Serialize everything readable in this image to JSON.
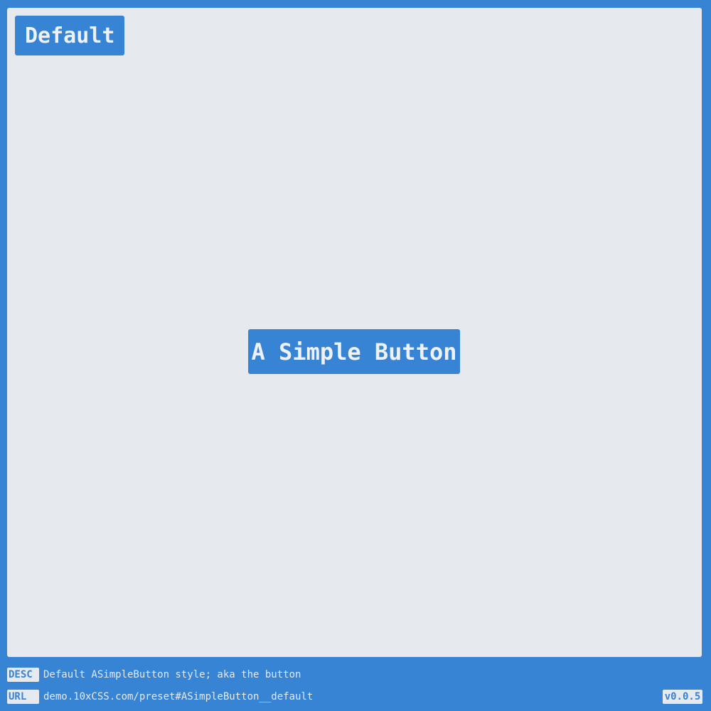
{
  "stage": {
    "title": "Default",
    "button_label": "A Simple Button"
  },
  "footer": {
    "desc_tag": "DESC",
    "desc_text": "Default ASimpleButton style; aka the button",
    "url_tag": "URL",
    "url_text": "demo.10xCSS.com/preset#ASimpleButton__default",
    "version": "v0.0.5"
  },
  "colors": {
    "accent": "#3783d4",
    "stage_background": "#e6eaef",
    "text_light": "#eef2f7"
  }
}
